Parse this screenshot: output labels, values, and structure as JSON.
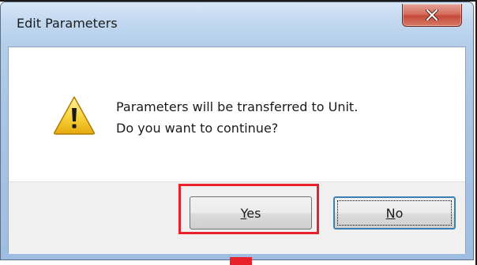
{
  "dialog": {
    "title": "Edit Parameters",
    "close_icon": "close-icon",
    "message_line1": "Parameters will be transferred to Unit.",
    "message_line2": "Do you want to continue?",
    "icon": "warning-icon",
    "buttons": {
      "yes_mnemonic": "Y",
      "yes_rest": "es",
      "no_mnemonic": "N",
      "no_rest": "o"
    }
  },
  "annotation": {
    "highlight_color": "#e8212a"
  },
  "colors": {
    "titlebar": "#c2d8f0",
    "close_button": "#c44a38",
    "focus_border": "#3c7fb1"
  }
}
